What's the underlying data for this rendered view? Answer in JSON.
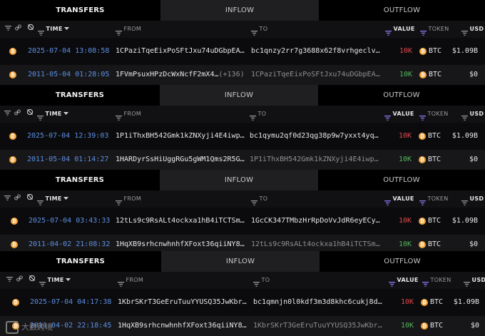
{
  "tabs": [
    "TRANSFERS",
    "INFLOW",
    "OUTFLOW"
  ],
  "columns": {
    "time": "TIME",
    "from": "FROM",
    "to": "TO",
    "value": "VALUE",
    "token": "TOKEN",
    "usd": "USD"
  },
  "icons": {
    "coin": "bitcoin-coin-icon",
    "filter": "filter-icon",
    "link": "link-icon",
    "hide": "eye-off-icon",
    "sort": "caret-down-icon"
  },
  "colors": {
    "time": "#5c8fe0",
    "value_out": "#e0484a",
    "value_in": "#52b45a",
    "coin": "#f2a33a"
  },
  "panels": [
    {
      "rows": [
        {
          "time": "2025-07-04 13:08:58",
          "from": "1CPaziTqeEixPoSFtJxu74uDGbpEA…",
          "from_extra": "",
          "to": "bc1qnzy2rr7g3688x62f8vrhgeclv…",
          "value": "10K",
          "token": "BTC",
          "usd": "$1.09B"
        },
        {
          "time": "2011-05-04 01:28:05",
          "from": "1FVmPsuxHPzDcWxNcfF2mX4…",
          "from_extra": "(+136)",
          "to": "1CPaziTqeEixPoSFtJxu74uDGbpEA…",
          "value": "10K",
          "token": "BTC",
          "usd": "$0"
        }
      ]
    },
    {
      "rows": [
        {
          "time": "2025-07-04 12:39:03",
          "from": "1P1iThxBH542Gmk1kZNXyji4E4iwp…",
          "from_extra": "",
          "to": "bc1qymu2qf0d23qg38p9w7yxxt4yq…",
          "value": "10K",
          "token": "BTC",
          "usd": "$1.09B"
        },
        {
          "time": "2011-05-04 01:14:27",
          "from": "1HARDyrSsHiUggRGu5gWM1Qms2R5G…",
          "from_extra": "",
          "to": "1P1iThxBH542Gmk1kZNXyji4E4iwp…",
          "value": "10K",
          "token": "BTC",
          "usd": "$0"
        }
      ]
    },
    {
      "rows": [
        {
          "time": "2025-07-04 03:43:33",
          "from": "12tLs9c9RsALt4ockxa1hB4iTCTSm…",
          "from_extra": "",
          "to": "1GcCK347TMbzHrRpDoVvJdR6eyECy…",
          "value": "10K",
          "token": "BTC",
          "usd": "$1.09B"
        },
        {
          "time": "2011-04-02 21:08:32",
          "from": "1HqXB9srhcnwhnhfXFoxt36qiiNY8…",
          "from_extra": "",
          "to": "12tLs9c9RsALt4ockxa1hB4iTCTSm…",
          "value": "10K",
          "token": "BTC",
          "usd": "$0"
        }
      ]
    },
    {
      "rows": [
        {
          "time": "2025-07-04 04:17:38",
          "from": "1KbrSKrT3GeEruTuuYYUSQ35JwKbr…",
          "from_extra": "",
          "to": "bc1qmnjn0l0kdf3m3d8khc6cukj8d…",
          "value": "10K",
          "token": "BTC",
          "usd": "$1.09B"
        },
        {
          "time": "2011-04-02 22:18:45",
          "from": "1HqXB9srhcnwhnhfXFoxt36qiiNY8…",
          "from_extra": "",
          "to": "1KbrSKrT3GeEruTuuYYUSQ35JwKbr…",
          "value": "10K",
          "token": "BTC",
          "usd": "$0"
        }
      ]
    }
  ],
  "watermark": "大数跨境"
}
